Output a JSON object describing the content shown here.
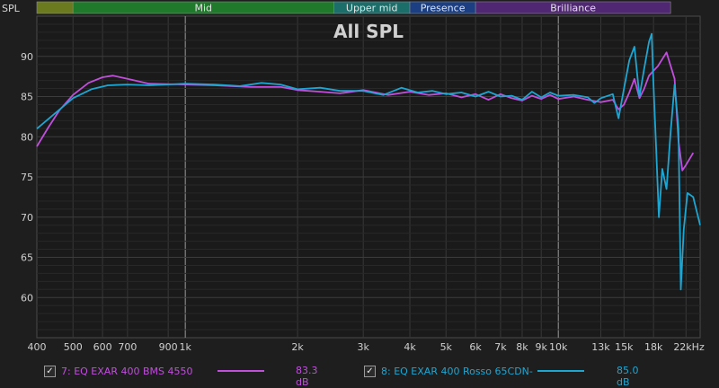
{
  "chart_data": {
    "type": "line",
    "title": "All SPL",
    "ylabel": "SPL",
    "xlabel": "",
    "x_unit": "Hz",
    "x_scale": "log",
    "xlim": [
      400,
      24000
    ],
    "ylim": [
      55,
      95
    ],
    "grid": true,
    "x_ticks": [
      {
        "value": 400,
        "label": "400"
      },
      {
        "value": 500,
        "label": "500"
      },
      {
        "value": 600,
        "label": "600"
      },
      {
        "value": 700,
        "label": "700"
      },
      {
        "value": 900,
        "label": "900"
      },
      {
        "value": 1000,
        "label": "1k"
      },
      {
        "value": 2000,
        "label": "2k"
      },
      {
        "value": 3000,
        "label": "3k"
      },
      {
        "value": 4000,
        "label": "4k"
      },
      {
        "value": 5000,
        "label": "5k"
      },
      {
        "value": 6000,
        "label": "6k"
      },
      {
        "value": 7000,
        "label": "7k"
      },
      {
        "value": 8000,
        "label": "8k"
      },
      {
        "value": 9000,
        "label": "9k"
      },
      {
        "value": 10000,
        "label": "10k"
      },
      {
        "value": 13000,
        "label": "13k"
      },
      {
        "value": 15000,
        "label": "15k"
      },
      {
        "value": 18000,
        "label": "18k"
      },
      {
        "value": 22000,
        "label": "22kHz"
      }
    ],
    "y_ticks": [
      {
        "value": 90,
        "label": "90"
      },
      {
        "value": 85,
        "label": "85"
      },
      {
        "value": 80,
        "label": "80"
      },
      {
        "value": 75,
        "label": "75"
      },
      {
        "value": 70,
        "label": "70"
      },
      {
        "value": 65,
        "label": "65"
      },
      {
        "value": 60,
        "label": "60"
      }
    ],
    "bands": [
      {
        "name": "",
        "from": 400,
        "to": 500,
        "color": "#6b7a1e"
      },
      {
        "name": "Mid",
        "from": 500,
        "to": 2500,
        "color": "#1f7a2c"
      },
      {
        "name": "Upper mid",
        "from": 2500,
        "to": 4000,
        "color": "#1c6e6a"
      },
      {
        "name": "Presence",
        "from": 4000,
        "to": 6000,
        "color": "#1b3f82"
      },
      {
        "name": "Brilliance",
        "from": 6000,
        "to": 20000,
        "color": "#4f2772"
      }
    ],
    "series": [
      {
        "name": "7: EQ EXAR 400 BMS 4550",
        "value_label": "83.3 dB",
        "color": "#c04fdc",
        "checked": true,
        "points": [
          [
            400,
            78.8
          ],
          [
            430,
            81.2
          ],
          [
            460,
            83.3
          ],
          [
            500,
            85.2
          ],
          [
            550,
            86.7
          ],
          [
            600,
            87.4
          ],
          [
            640,
            87.6
          ],
          [
            700,
            87.2
          ],
          [
            800,
            86.6
          ],
          [
            1000,
            86.5
          ],
          [
            1200,
            86.4
          ],
          [
            1500,
            86.2
          ],
          [
            1800,
            86.2
          ],
          [
            2000,
            85.8
          ],
          [
            2300,
            85.6
          ],
          [
            2600,
            85.4
          ],
          [
            3000,
            85.8
          ],
          [
            3500,
            85.2
          ],
          [
            4000,
            85.6
          ],
          [
            4500,
            85.2
          ],
          [
            5000,
            85.4
          ],
          [
            5500,
            84.9
          ],
          [
            6000,
            85.3
          ],
          [
            6500,
            84.6
          ],
          [
            7000,
            85.3
          ],
          [
            7500,
            84.8
          ],
          [
            8000,
            84.5
          ],
          [
            8500,
            85.1
          ],
          [
            9000,
            84.7
          ],
          [
            9500,
            85.2
          ],
          [
            10000,
            84.7
          ],
          [
            11000,
            85.0
          ],
          [
            12000,
            84.6
          ],
          [
            13000,
            84.3
          ],
          [
            14000,
            84.6
          ],
          [
            14500,
            83.4
          ],
          [
            15000,
            84.0
          ],
          [
            15500,
            85.5
          ],
          [
            16000,
            87.2
          ],
          [
            16500,
            84.8
          ],
          [
            17000,
            86.0
          ],
          [
            17500,
            87.6
          ],
          [
            18500,
            88.8
          ],
          [
            19500,
            90.5
          ],
          [
            20500,
            87.2
          ],
          [
            21000,
            79.5
          ],
          [
            21500,
            75.8
          ],
          [
            22000,
            76.5
          ],
          [
            23000,
            78.0
          ]
        ]
      },
      {
        "name": "8: EQ EXAR 400 Rosso 65CDN-",
        "value_label": "85.0 dB",
        "color": "#1ea6d2",
        "checked": true,
        "points": [
          [
            400,
            81.0
          ],
          [
            450,
            83.0
          ],
          [
            500,
            84.8
          ],
          [
            560,
            85.9
          ],
          [
            620,
            86.4
          ],
          [
            700,
            86.5
          ],
          [
            800,
            86.4
          ],
          [
            1000,
            86.6
          ],
          [
            1200,
            86.5
          ],
          [
            1400,
            86.3
          ],
          [
            1600,
            86.7
          ],
          [
            1800,
            86.5
          ],
          [
            2000,
            85.9
          ],
          [
            2300,
            86.1
          ],
          [
            2600,
            85.7
          ],
          [
            3000,
            85.7
          ],
          [
            3400,
            85.2
          ],
          [
            3800,
            86.1
          ],
          [
            4200,
            85.5
          ],
          [
            4600,
            85.7
          ],
          [
            5000,
            85.3
          ],
          [
            5500,
            85.5
          ],
          [
            6000,
            85.0
          ],
          [
            6500,
            85.6
          ],
          [
            7000,
            85.0
          ],
          [
            7500,
            85.1
          ],
          [
            8000,
            84.6
          ],
          [
            8500,
            85.6
          ],
          [
            9000,
            84.9
          ],
          [
            9500,
            85.5
          ],
          [
            10000,
            85.1
          ],
          [
            11000,
            85.2
          ],
          [
            12000,
            84.9
          ],
          [
            12500,
            84.2
          ],
          [
            13000,
            84.8
          ],
          [
            14000,
            85.3
          ],
          [
            14500,
            82.3
          ],
          [
            15000,
            86.0
          ],
          [
            15500,
            89.5
          ],
          [
            16000,
            91.2
          ],
          [
            16500,
            85.0
          ],
          [
            17000,
            88.5
          ],
          [
            17500,
            91.8
          ],
          [
            17800,
            92.8
          ],
          [
            18000,
            86.5
          ],
          [
            18300,
            78.5
          ],
          [
            18600,
            70.0
          ],
          [
            19000,
            76.0
          ],
          [
            19500,
            73.5
          ],
          [
            20000,
            80.5
          ],
          [
            20500,
            86.5
          ],
          [
            21000,
            81.0
          ],
          [
            21300,
            61.0
          ],
          [
            21700,
            68.5
          ],
          [
            22200,
            73.0
          ],
          [
            23000,
            72.5
          ],
          [
            24000,
            69.0
          ]
        ]
      }
    ]
  }
}
